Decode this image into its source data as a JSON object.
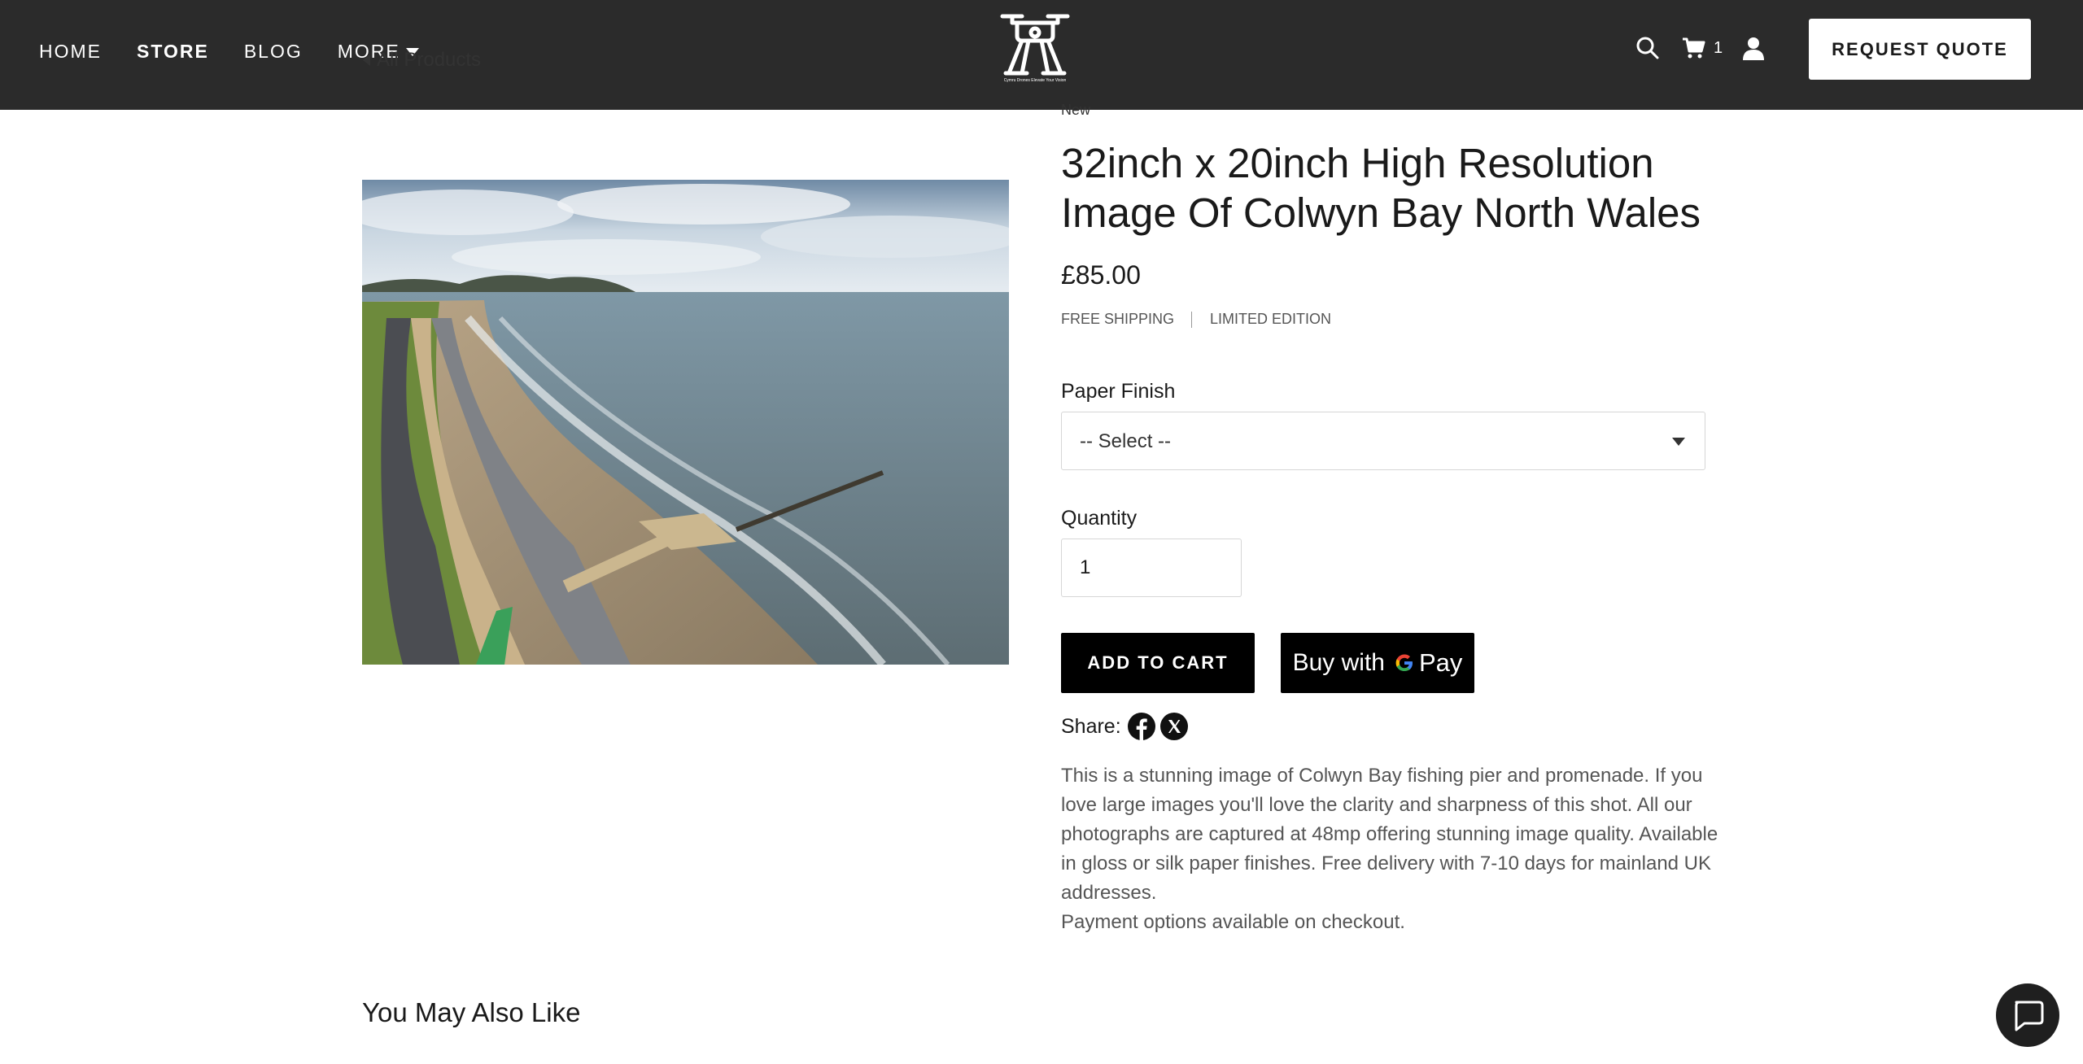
{
  "nav": {
    "home": "HOME",
    "store": "STORE",
    "blog": "BLOG",
    "more": "MORE"
  },
  "breadcrumb": {
    "back_label": "All Products"
  },
  "logo": {
    "caption": "Cymru Drones Elevate Your Vision"
  },
  "header": {
    "cart_count": "1",
    "quote_label": "REQUEST QUOTE"
  },
  "product": {
    "ribbon": "New",
    "title": "32inch x 20inch High Resolution Image Of Colwyn Bay North Wales",
    "price": "£85.00",
    "tags": [
      "FREE SHIPPING",
      "LIMITED EDITION"
    ],
    "finish_label": "Paper Finish",
    "finish_selected": "-- Select --",
    "quantity_label": "Quantity",
    "quantity_value": "1",
    "add_to_cart": "ADD TO CART",
    "gpay_prefix": "Buy with",
    "gpay_brand": "Pay",
    "share_label": "Share:",
    "description": [
      "This is a stunning image of Colwyn Bay fishing pier and promenade. If you love large images you'll love the clarity and sharpness of this shot. All our photographs are captured at 48mp offering stunning image quality. Available in gloss or silk paper finishes. Free delivery with 7-10 days for mainland UK addresses.",
      "Payment options available on checkout."
    ]
  },
  "related": {
    "heading": "You May Also Like"
  },
  "icons": {
    "search": "search-icon",
    "cart": "cart-icon",
    "account": "user-icon",
    "facebook": "facebook-icon",
    "x": "x-twitter-icon",
    "chat": "chat-icon"
  }
}
